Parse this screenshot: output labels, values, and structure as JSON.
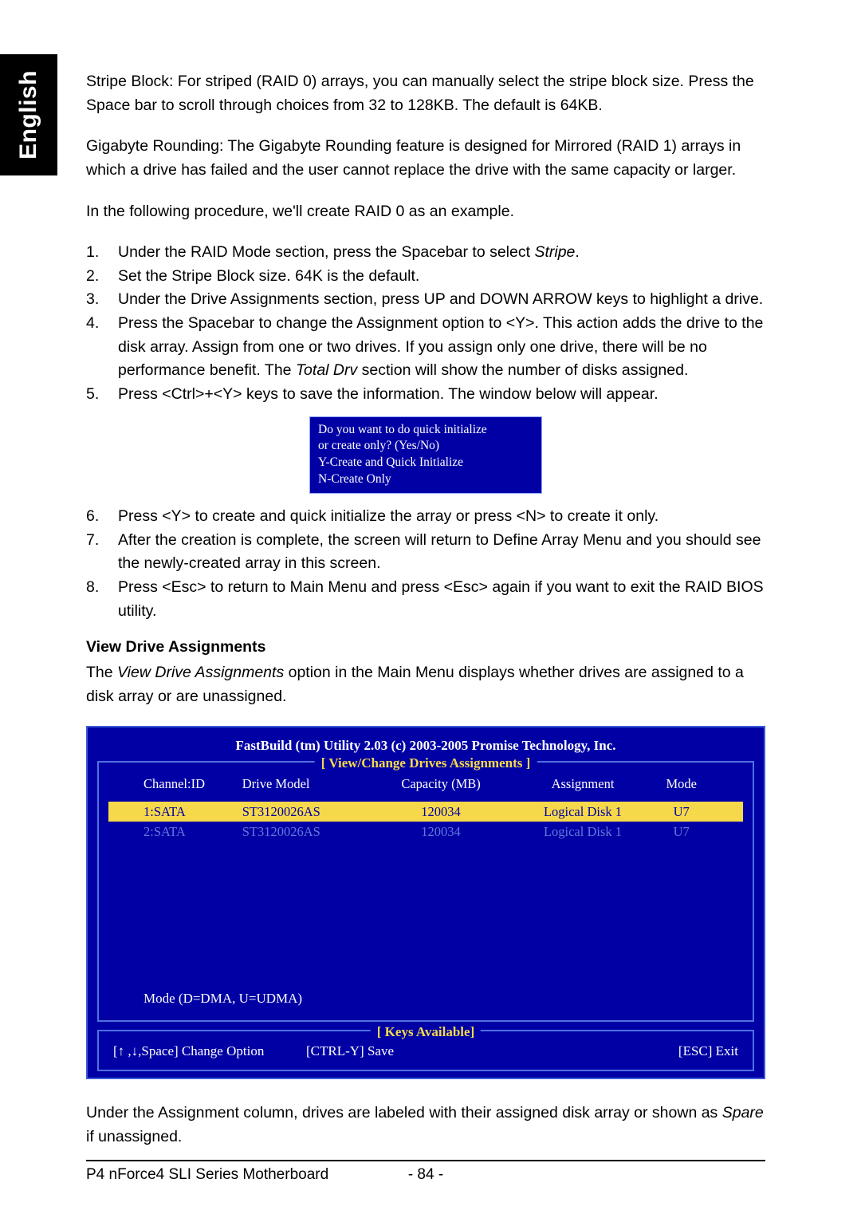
{
  "tab_label": "English",
  "para1": "Stripe Block: For striped (RAID 0) arrays, you can manually select the stripe block size. Press the Space bar to scroll through choices from 32 to 128KB. The default is 64KB.",
  "para2": "Gigabyte Rounding: The Gigabyte Rounding feature is designed for Mirrored (RAID 1) arrays in which a drive has failed and the user cannot replace the drive with the same capacity or larger.",
  "para3": "In the following procedure, we'll create RAID 0 as an example.",
  "steps_a": [
    {
      "n": "1.",
      "pre": "Under the RAID Mode section, press the Spacebar to select ",
      "em": "Stripe",
      "post": "."
    },
    {
      "n": "2.",
      "pre": "Set the Stripe Block size. 64K is the default.",
      "em": "",
      "post": ""
    },
    {
      "n": "3.",
      "pre": "Under the Drive Assignments section, press UP and DOWN ARROW keys to highlight a drive.",
      "em": "",
      "post": ""
    },
    {
      "n": "4.",
      "pre": "Press the Spacebar to change the Assignment option to <Y>.  This action adds the drive to the disk array. Assign from one or two drives. If you assign only one drive, there will be no performance benefit. The ",
      "em": "Total Drv",
      "post": " section will show the number of disks assigned."
    },
    {
      "n": "5.",
      "pre": "Press <Ctrl>+<Y> keys to save the information. The window below will appear.",
      "em": "",
      "post": ""
    }
  ],
  "dialog": {
    "l1": "Do you want to do quick initialize",
    "l2": "or create only? (Yes/No)",
    "l3": "Y-Create and Quick Initialize",
    "l4": "N-Create Only"
  },
  "steps_b": [
    {
      "n": "6.",
      "t": "Press <Y> to create and quick initialize the array or press <N> to create it only."
    },
    {
      "n": "7.",
      "t": "After the creation is complete, the screen will return to Define Array Menu and you should see the newly-created array in this screen."
    },
    {
      "n": "8.",
      "t": "Press <Esc> to return to Main Menu and press <Esc> again if you want to exit the RAID BIOS utility."
    }
  ],
  "section_head": "View Drive Assignments",
  "section_body_pre": "The ",
  "section_body_em": "View Drive Assignments",
  "section_body_post": " option in the Main Menu displays whether drives are assigned to a disk array or are unassigned.",
  "bios": {
    "title": "FastBuild (tm) Utility 2.03 (c) 2003-2005 Promise Technology, Inc.",
    "panel_label": "[ View/Change Drives Assignments ]",
    "head": {
      "c1": "Channel:ID",
      "c2": "Drive Model",
      "c3": "Capacity (MB)",
      "c4": "Assignment",
      "c5": "Mode"
    },
    "rows": [
      {
        "c1": "1:SATA",
        "c2": "ST3120026AS",
        "c3": "120034",
        "c4": "Logical Disk 1",
        "c5": "U7",
        "active": true
      },
      {
        "c1": "2:SATA",
        "c2": "ST3120026AS",
        "c3": "120034",
        "c4": "Logical Disk 1",
        "c5": "U7",
        "active": false
      }
    ],
    "note": "Mode  (D=DMA, U=UDMA)",
    "keys_label": "[  Keys Available]",
    "key_left": "[↑ ,↓,Space] Change Option",
    "key_mid": "[CTRL-Y] Save",
    "key_right": "[ESC] Exit"
  },
  "after_pre": "Under the Assignment column, drives are labeled with their assigned disk array or shown as ",
  "after_em": "Spare",
  "after_post": " if unassigned.",
  "footer_left": "P4 nForce4 SLI Series Motherboard",
  "footer_page": "- 84 -"
}
